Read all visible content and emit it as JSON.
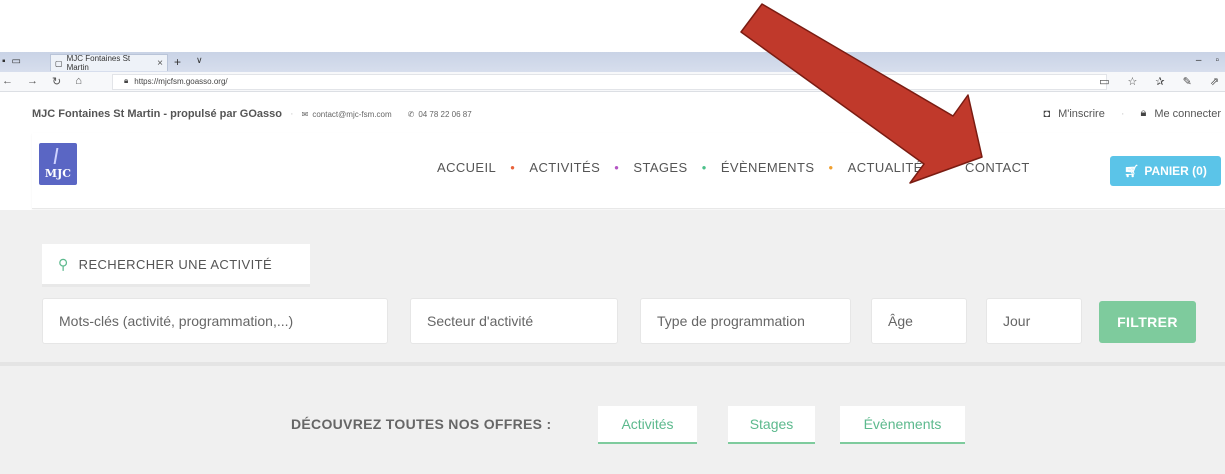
{
  "browser": {
    "tab_title": "MJC Fontaines St Martin",
    "tab_close": "×",
    "new_tab": "+",
    "tab_menu": "∨",
    "url": "https://mjcfsm.goasso.org/"
  },
  "site_top": {
    "name": "MJC Fontaines St Martin - propulsé par GOasso",
    "email": "contact@mjc-fsm.com",
    "phone": "04 78 22 06 87",
    "signup": "M'inscrire",
    "login": "Me connecter"
  },
  "header": {
    "logo_text": "MJC",
    "menu": [
      "ACCUEIL",
      "ACTIVITÉS",
      "STAGES",
      "ÉVÈNEMENTS",
      "ACTUALITÉS",
      "CONTACT"
    ],
    "menu_dot_colors": [
      "#e8623a",
      "#b455c4",
      "#4cc08a",
      "#f0a030",
      "#5bc4e8"
    ],
    "cart_label": "PANIER (0)"
  },
  "search": {
    "tab_label": "RECHERCHER UNE ACTIVITÉ",
    "keywords_placeholder": "Mots-clés (activité, programmation,...)",
    "sector_placeholder": "Secteur d'activité",
    "type_placeholder": "Type de programmation",
    "age_placeholder": "Âge",
    "day_placeholder": "Jour",
    "filter_label": "FILTRER"
  },
  "offers": {
    "label": "DÉCOUVREZ TOUTES NOS OFFRES :",
    "buttons": [
      "Activités",
      "Stages",
      "Évènements"
    ]
  },
  "colors": {
    "accent_green": "#7ecb9d",
    "cart_blue": "#5bc4e8",
    "logo_blue": "#5a66c4",
    "arrow_red": "#c0392b"
  }
}
